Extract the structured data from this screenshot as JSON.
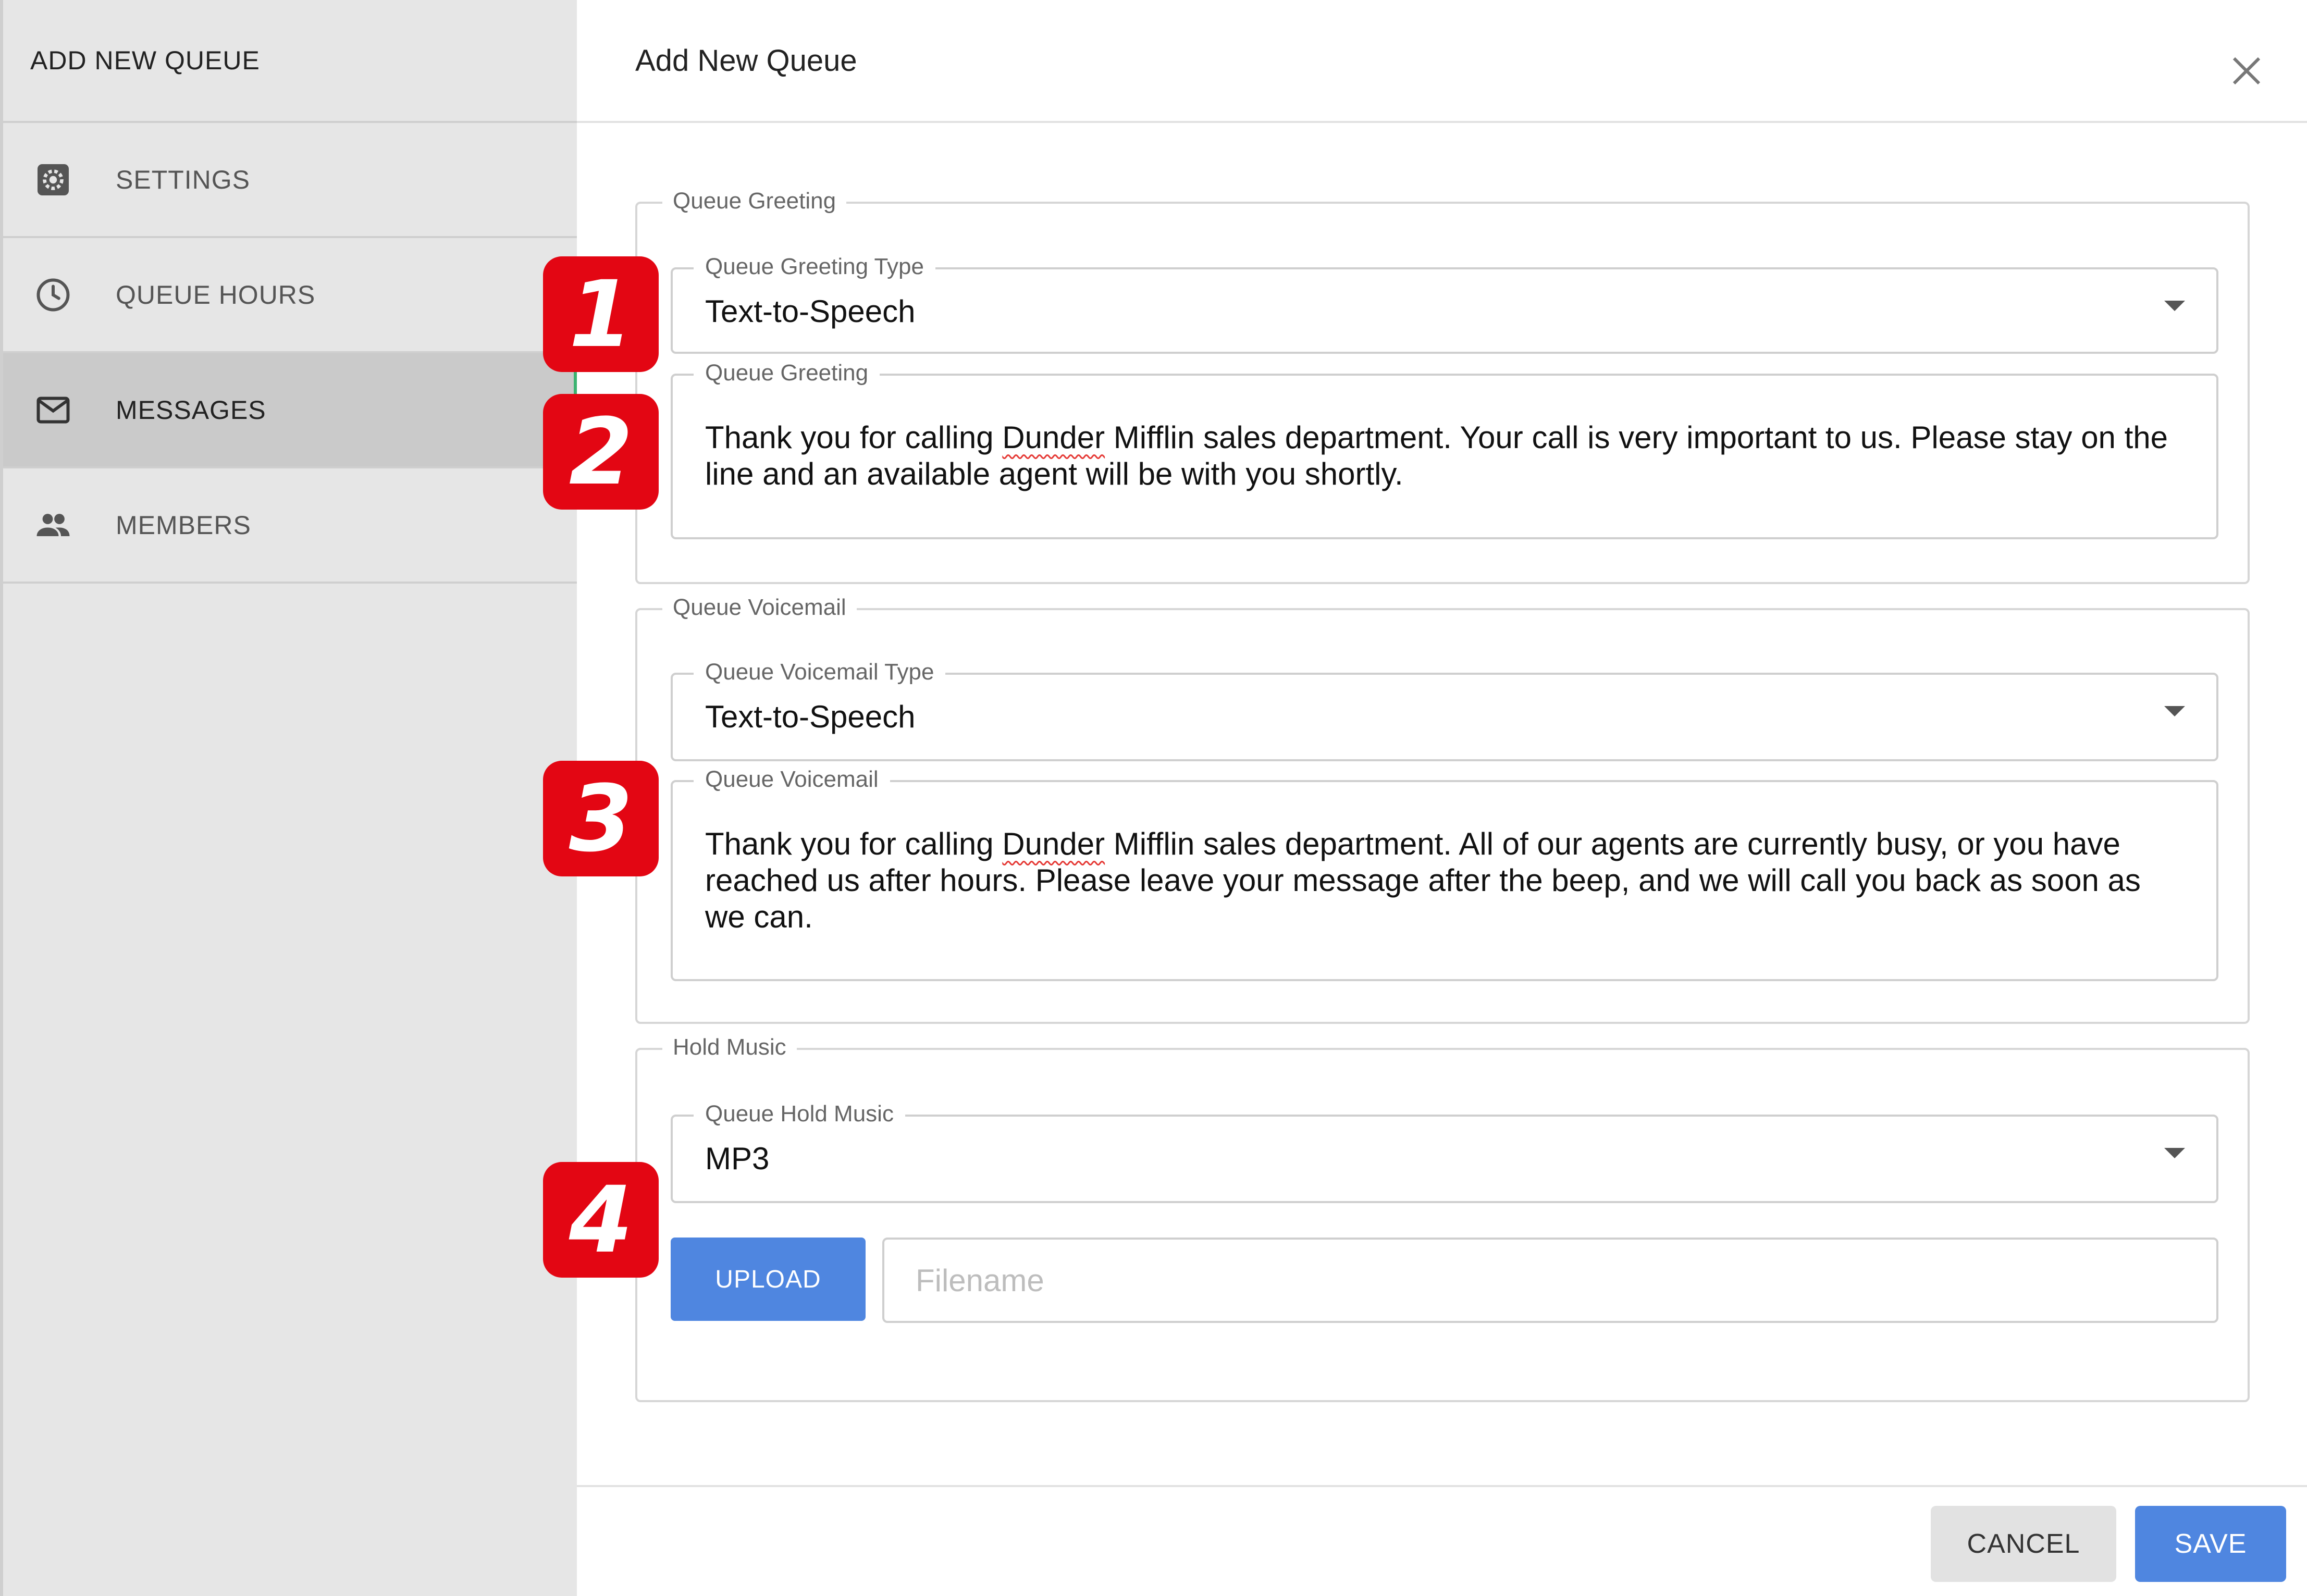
{
  "sidebar": {
    "title": "ADD NEW QUEUE",
    "items": [
      {
        "label": "SETTINGS",
        "icon": "gear-icon"
      },
      {
        "label": "QUEUE HOURS",
        "icon": "clock-icon"
      },
      {
        "label": "MESSAGES",
        "icon": "envelope-icon",
        "active": true
      },
      {
        "label": "MEMBERS",
        "icon": "people-icon"
      }
    ]
  },
  "header": {
    "title": "Add New Queue"
  },
  "queue_greeting": {
    "legend": "Queue Greeting",
    "type_label": "Queue Greeting Type",
    "type_value": "Text-to-Speech",
    "greeting_label": "Queue Greeting",
    "greeting_text_before": "Thank you for calling ",
    "greeting_text_highlight": "Dunder",
    "greeting_text_after": " Mifflin sales department. Your call is very important to us. Please stay on the line and an available agent will be with you shortly."
  },
  "queue_voicemail": {
    "legend": "Queue Voicemail",
    "type_label": "Queue Voicemail Type",
    "type_value": "Text-to-Speech",
    "voicemail_label": "Queue Voicemail",
    "voicemail_text_before": "Thank you for calling ",
    "voicemail_text_highlight": "Dunder",
    "voicemail_text_after": " Mifflin sales department. All of our agents are currently busy, or you have reached us after hours. Please leave your message after the beep, and we will call you back as soon as we can."
  },
  "hold_music": {
    "legend": "Hold Music",
    "type_label": "Queue Hold Music",
    "type_value": "MP3",
    "upload_label": "UPLOAD",
    "filename_placeholder": "Filename",
    "filename_value": ""
  },
  "footer": {
    "cancel_label": "CANCEL",
    "save_label": "SAVE"
  },
  "callouts": [
    "1",
    "2",
    "3",
    "4"
  ],
  "colors": {
    "accent": "#4f86e0",
    "callout": "#e30613",
    "sidebar_bg": "#e6e6e6",
    "sidebar_active": "#cacaca"
  }
}
